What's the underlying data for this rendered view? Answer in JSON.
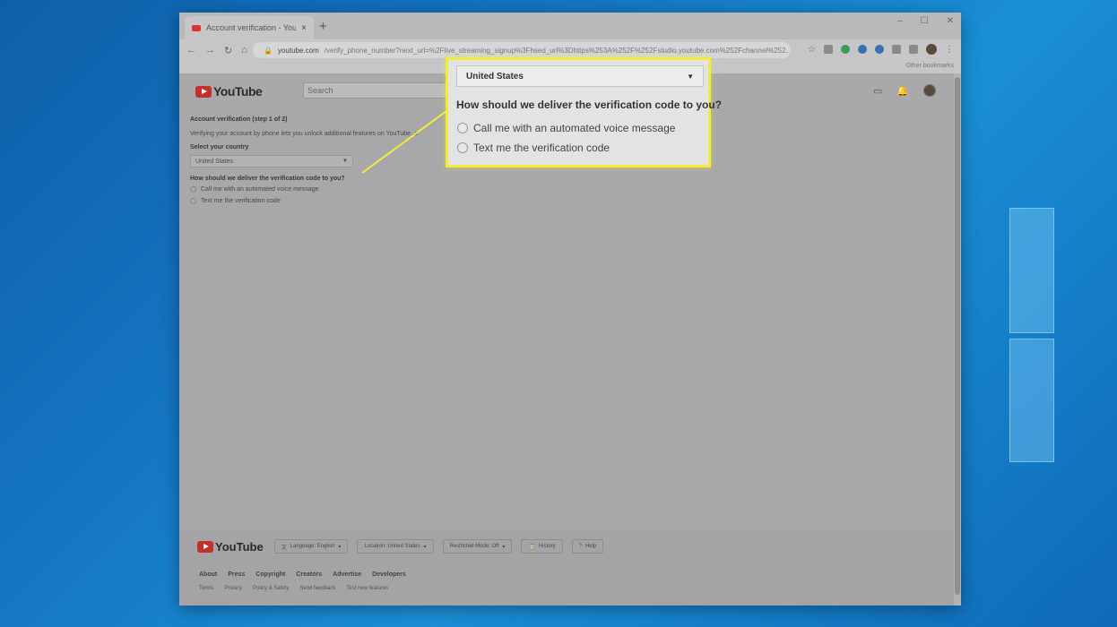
{
  "browser": {
    "tab_title": "Account verification - YouTube",
    "tab_close": "×",
    "new_tab": "+",
    "window_controls": [
      "–",
      "☐",
      "✕"
    ],
    "url_domain": "youtube.com",
    "url_path": "/verify_phone_number?next_url=%2Flive_streaming_signup%3Fhsed_url%3Dhttps%253A%252F%252Fstudio.youtube.com%252Fchannel%252...",
    "other_bookmarks": "Other bookmarks"
  },
  "youtube": {
    "logo_text": "YouTube",
    "search_placeholder": "Search"
  },
  "verification": {
    "heading": "Account verification (step 1 of 2)",
    "intro": "Verifying your account by phone lets you unlock additional features on YouTube, a",
    "country_label": "Select your country",
    "country_value": "United States",
    "question": "How should we deliver the verification code to you?",
    "option_voice": "Call me with an automated voice message",
    "option_text": "Text me the verification code"
  },
  "callout": {
    "country_value": "United States",
    "question": "How should we deliver the verification code to you?",
    "option_voice": "Call me with an automated voice message",
    "option_text": "Text me the verification code"
  },
  "footer": {
    "logo_text": "YouTube",
    "language": "Language: English",
    "location": "Location: United States",
    "restricted": "Restricted Mode: Off",
    "history": "History",
    "help": "Help",
    "links_primary": [
      "About",
      "Press",
      "Copyright",
      "Creators",
      "Advertise",
      "Developers"
    ],
    "links_secondary": [
      "Terms",
      "Privacy",
      "Policy & Safety",
      "Send feedback",
      "Test new features"
    ]
  },
  "colors": {
    "highlight_border": "#f0ec3a",
    "youtube_red": "#c4302b",
    "desktop_blue": "#1577c4"
  }
}
